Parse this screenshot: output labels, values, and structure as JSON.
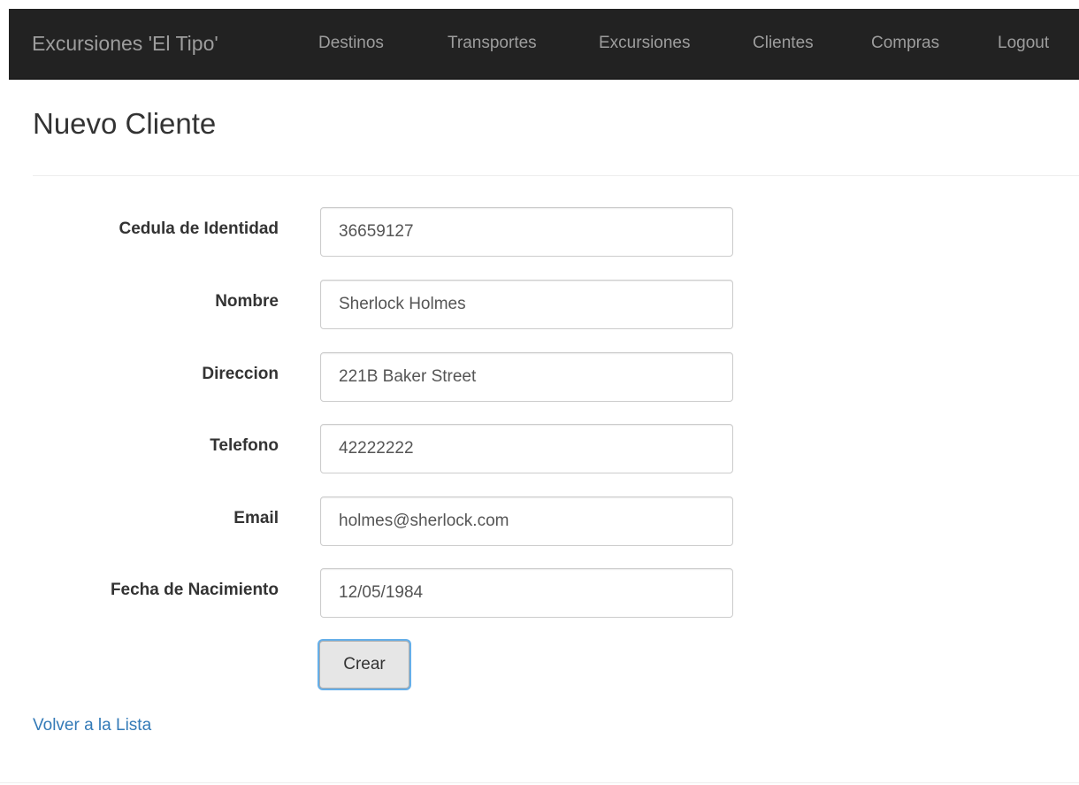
{
  "navbar": {
    "brand": "Excursiones 'El Tipo'",
    "items": [
      {
        "label": "Destinos"
      },
      {
        "label": "Transportes"
      },
      {
        "label": "Excursiones"
      },
      {
        "label": "Clientes"
      },
      {
        "label": "Compras"
      },
      {
        "label": "Logout"
      }
    ]
  },
  "page": {
    "title": "Nuevo Cliente"
  },
  "form": {
    "fields": [
      {
        "label": "Cedula de Identidad",
        "value": "36659127"
      },
      {
        "label": "Nombre",
        "value": "Sherlock Holmes"
      },
      {
        "label": "Direccion",
        "value": "221B Baker Street"
      },
      {
        "label": "Telefono",
        "value": "42222222"
      },
      {
        "label": "Email",
        "value": "holmes@sherlock.com"
      },
      {
        "label": "Fecha de Nacimiento",
        "value": "12/05/1984"
      }
    ],
    "submit_label": "Crear"
  },
  "back_link": "Volver a la Lista",
  "colors": {
    "navbar_bg": "#222222",
    "navbar_text": "#9d9d9d",
    "link": "#337ab7",
    "button_bg": "#e6e6e6",
    "focus_ring": "#66afe9"
  }
}
